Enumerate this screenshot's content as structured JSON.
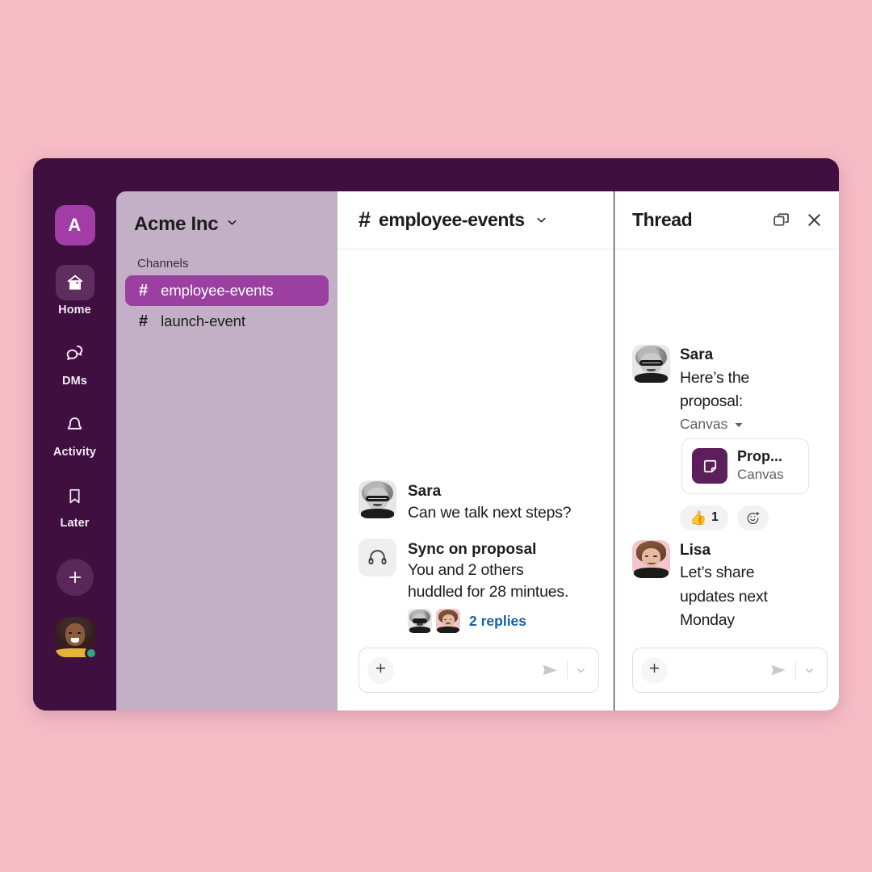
{
  "colors": {
    "page_background": "#f6bcc6",
    "window_chrome": "#3f0f3f",
    "sidebar": "#c3b0c6",
    "accent_selected": "#9b3fa0",
    "workspace_badge": "#a23da7",
    "link": "#1164a3",
    "canvas_icon": "#5c1f5c",
    "presence_online": "#2bac76"
  },
  "window": {
    "traffic_lights": [
      "close-red",
      "minimize-yellow",
      "maximize-green"
    ]
  },
  "rail": {
    "workspace_initial": "A",
    "items": [
      {
        "icon": "home-icon",
        "label": "Home",
        "active": true
      },
      {
        "icon": "dms-icon",
        "label": "DMs",
        "active": false
      },
      {
        "icon": "bell-icon",
        "label": "Activity",
        "active": false
      },
      {
        "icon": "bookmark-icon",
        "label": "Later",
        "active": false
      }
    ],
    "new_button_icon": "plus-icon",
    "user_avatar": "user-avatar",
    "presence": "online"
  },
  "sidebar": {
    "workspace_name": "Acme Inc",
    "workspace_chevron": "chevron-down-icon",
    "section_label": "Channels",
    "channels": [
      {
        "hash": "#",
        "name": "employee-events",
        "selected": true
      },
      {
        "hash": "#",
        "name": "launch-event",
        "selected": false
      }
    ]
  },
  "channel": {
    "hash": "#",
    "title": "employee-events",
    "chevron": "chevron-down-icon",
    "messages": [
      {
        "author": "Sara",
        "text": "Can we talk next steps?",
        "avatar": "sara-avatar"
      }
    ],
    "huddle": {
      "icon": "headphones-icon",
      "title": "Sync on proposal",
      "line1": "You and 2 others",
      "line2": "huddled for 28 mintues.",
      "replies_label": "2 replies",
      "facepile": [
        "sara-avatar",
        "lisa-avatar"
      ]
    },
    "composer": {
      "plus_icon": "plus-icon",
      "send_icon": "send-icon",
      "send_options_icon": "chevron-down-icon",
      "placeholder": ""
    }
  },
  "thread": {
    "title": "Thread",
    "actions": [
      {
        "icon": "open-in-split-icon"
      },
      {
        "icon": "close-icon"
      }
    ],
    "messages": [
      {
        "author": "Sara",
        "avatar": "sara-avatar",
        "text_line1": "Here’s the",
        "text_line2": "proposal:",
        "attachment_kind": "Canvas",
        "attachment_kind_chevron": "caret-down-icon",
        "canvas_card": {
          "icon": "canvas-icon",
          "title": "Prop...",
          "subtitle": "Canvas"
        },
        "reactions": [
          {
            "emoji": "👍",
            "count": "1",
            "name": "thumbsup-reaction"
          },
          {
            "emoji": "",
            "count": "",
            "name": "add-reaction-button"
          }
        ]
      },
      {
        "author": "Lisa",
        "avatar": "lisa-avatar",
        "text_line1": "Let’s share",
        "text_line2": "updates next",
        "text_line3": "Monday"
      }
    ],
    "composer": {
      "plus_icon": "plus-icon",
      "send_icon": "send-icon",
      "send_options_icon": "chevron-down-icon",
      "placeholder": ""
    }
  }
}
